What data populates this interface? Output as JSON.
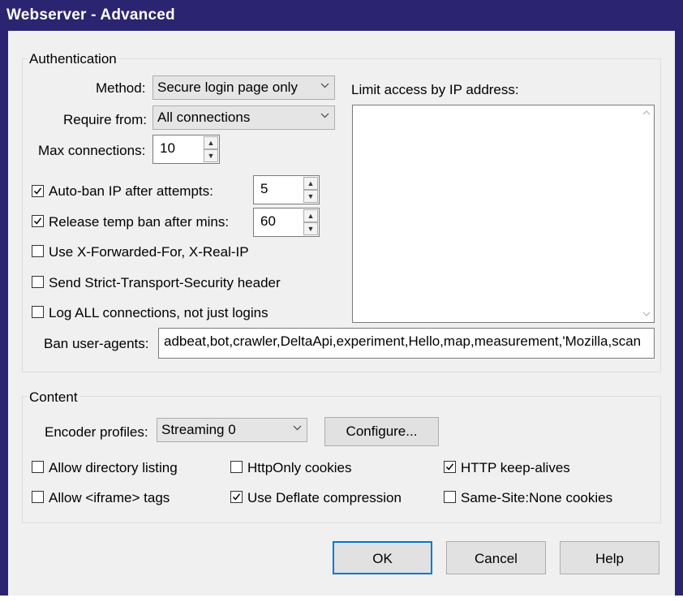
{
  "window": {
    "title": "Webserver - Advanced"
  },
  "authentication": {
    "group_label": "Authentication",
    "method_label": "Method:",
    "method_value": "Secure login page only",
    "require_label": "Require from:",
    "require_value": "All connections",
    "maxconn_label": "Max connections:",
    "maxconn_value": "10",
    "autoban_label": "Auto-ban IP after attempts:",
    "autoban_checked": true,
    "autoban_value": "5",
    "release_label": "Release temp ban after mins:",
    "release_checked": true,
    "release_value": "60",
    "xforwarded_label": "Use X-Forwarded-For, X-Real-IP",
    "xforwarded_checked": false,
    "hsts_label": "Send Strict-Transport-Security header",
    "hsts_checked": false,
    "logall_label": "Log ALL connections, not just logins",
    "logall_checked": false,
    "limit_ip_label": "Limit access by IP address:",
    "limit_ip_value": "",
    "ban_agents_label": "Ban user-agents:",
    "ban_agents_value": "adbeat,bot,crawler,DeltaApi,experiment,Hello,map,measurement,'Mozilla,scan"
  },
  "content": {
    "group_label": "Content",
    "encoder_label": "Encoder profiles:",
    "encoder_value": "Streaming 0",
    "configure_label": "Configure...",
    "options": {
      "dir_listing": {
        "label": "Allow directory listing",
        "checked": false
      },
      "httponly": {
        "label": "HttpOnly cookies",
        "checked": false
      },
      "keepalive": {
        "label": "HTTP keep-alives",
        "checked": true
      },
      "iframe": {
        "label": "Allow <iframe> tags",
        "checked": false
      },
      "deflate": {
        "label": "Use Deflate compression",
        "checked": true
      },
      "samesite": {
        "label": "Same-Site:None cookies",
        "checked": false
      }
    }
  },
  "buttons": {
    "ok": "OK",
    "cancel": "Cancel",
    "help": "Help"
  },
  "icons": {
    "dropdown": "chevron-down-icon",
    "spin_up": "spin-up-icon",
    "spin_down": "spin-down-icon",
    "check": "checkmark-icon",
    "scroll_up": "scroll-up-icon",
    "scroll_down": "scroll-down-icon"
  },
  "colors": {
    "titlebar": "#2b2571",
    "default_button_border": "#0078d7",
    "dialog_bg": "#f0f0f0"
  }
}
